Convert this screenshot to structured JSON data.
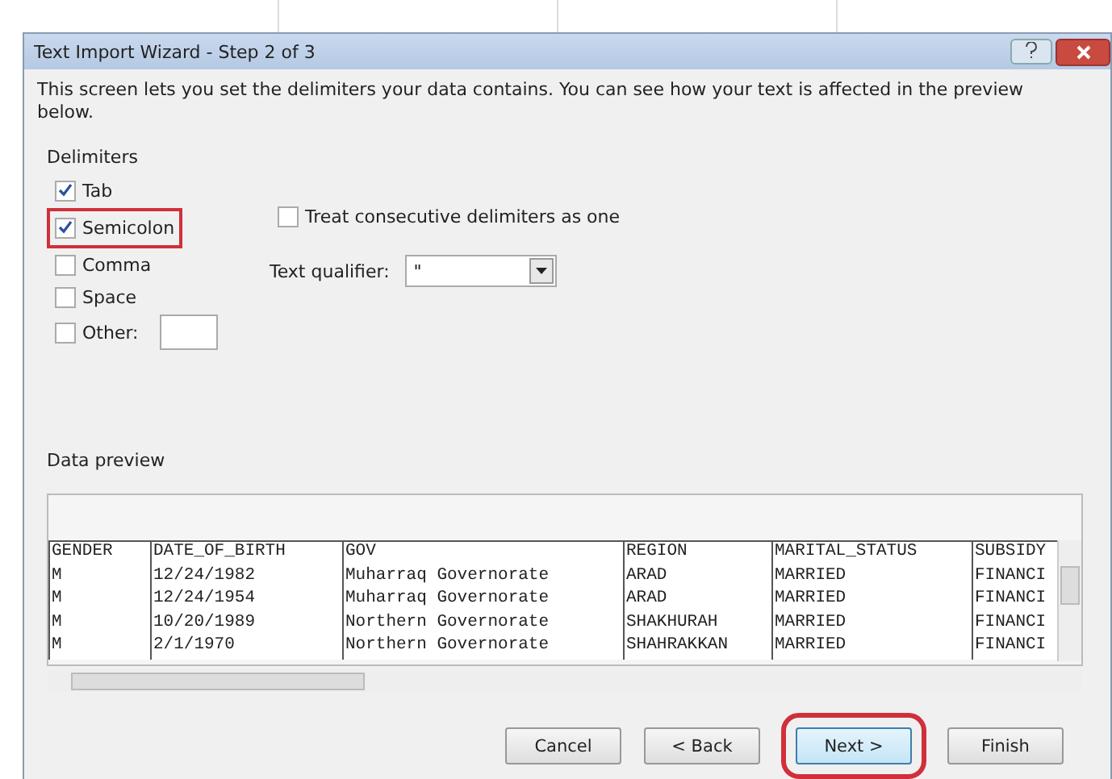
{
  "window": {
    "title": "Text Import Wizard - Step 2 of 3"
  },
  "description": "This screen lets you set the delimiters your data contains.  You can see how your text is affected in the preview below.",
  "delimiters": {
    "title": "Delimiters",
    "items": [
      {
        "label": "Tab",
        "checked": true,
        "highlighted": false
      },
      {
        "label": "Semicolon",
        "checked": true,
        "highlighted": true
      },
      {
        "label": "Comma",
        "checked": false,
        "highlighted": false
      },
      {
        "label": "Space",
        "checked": false,
        "highlighted": false
      },
      {
        "label": "Other:",
        "checked": false,
        "highlighted": false,
        "kind": "other"
      }
    ]
  },
  "treat_consecutive": {
    "label": "Treat consecutive delimiters as one",
    "checked": false
  },
  "text_qualifier": {
    "label": "Text qualifier:",
    "value": "\""
  },
  "preview": {
    "title": "Data preview",
    "columns": [
      {
        "cells": [
          "GENDER",
          "M",
          "M",
          "M",
          "M"
        ]
      },
      {
        "cells": [
          "DATE_OF_BIRTH",
          "12/24/1982",
          "12/24/1954",
          "10/20/1989",
          "2/1/1970"
        ]
      },
      {
        "cells": [
          "GOV",
          "Muharraq Governorate",
          "Muharraq Governorate",
          "Northern Governorate",
          "Northern Governorate"
        ]
      },
      {
        "cells": [
          "REGION",
          "ARAD",
          "ARAD",
          "SHAKHURAH",
          "SHAHRAKKAN"
        ]
      },
      {
        "cells": [
          "MARITAL_STATUS",
          "MARRIED",
          "MARRIED",
          "MARRIED",
          "MARRIED"
        ]
      },
      {
        "cells": [
          "SUBSIDY",
          "FINANCI",
          "FINANCI",
          "FINANCI",
          "FINANCI"
        ]
      }
    ]
  },
  "buttons": [
    {
      "label": "Cancel",
      "highlighted": false
    },
    {
      "label": "< Back",
      "highlighted": false
    },
    {
      "label": "Next >",
      "highlighted": true
    },
    {
      "label": "Finish",
      "highlighted": false
    }
  ]
}
